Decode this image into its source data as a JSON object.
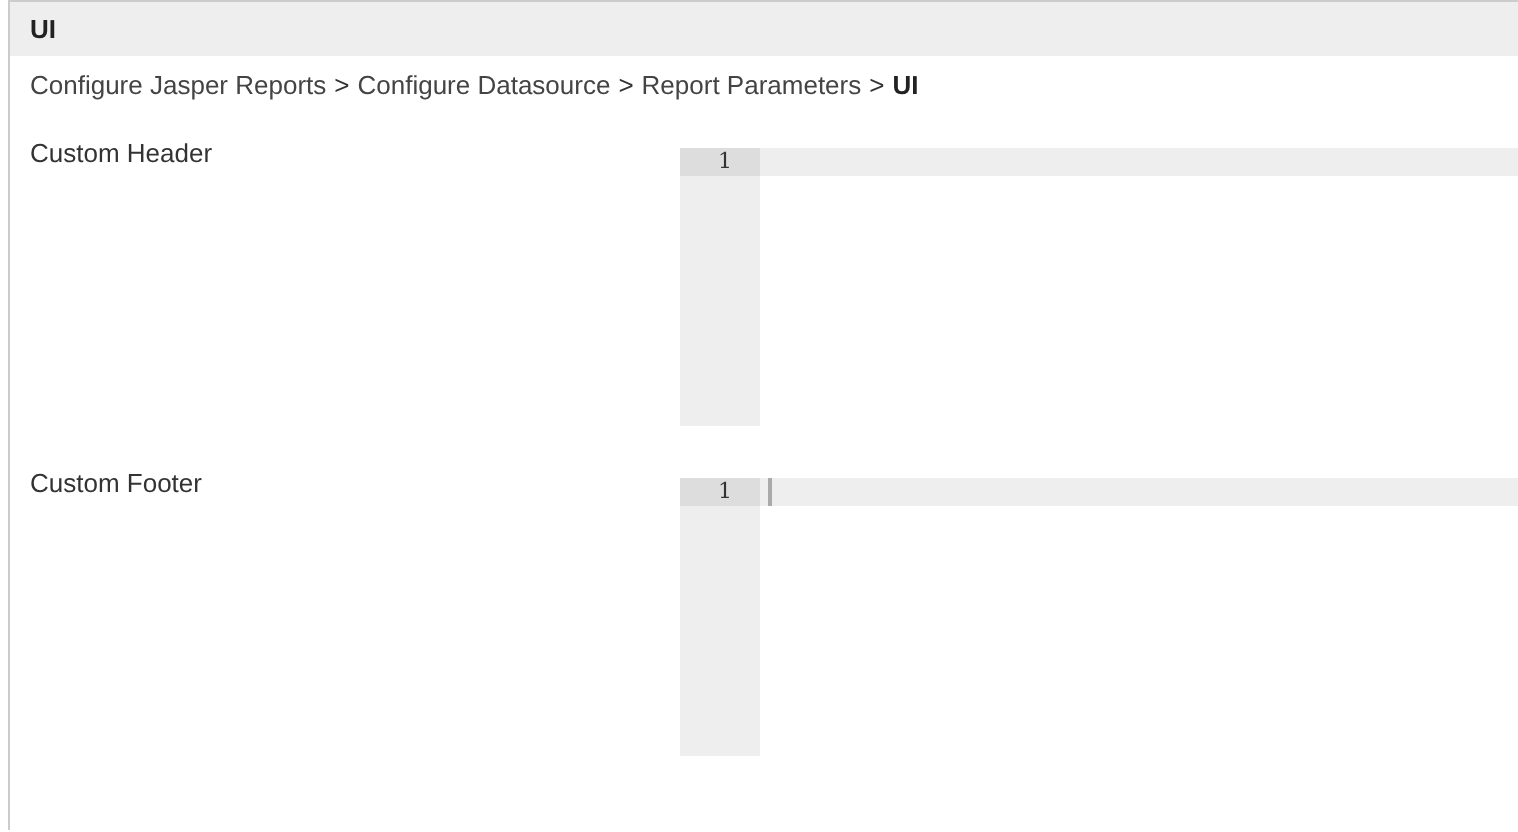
{
  "panel": {
    "title": "UI"
  },
  "breadcrumb": [
    {
      "kind": "link",
      "text": "Configure Jasper Reports"
    },
    {
      "kind": "separator",
      "text": ">"
    },
    {
      "kind": "link",
      "text": "Configure Datasource"
    },
    {
      "kind": "separator",
      "text": ">"
    },
    {
      "kind": "link",
      "text": "Report Parameters"
    },
    {
      "kind": "separator",
      "text": ">"
    },
    {
      "kind": "current",
      "text": "UI"
    }
  ],
  "fields": [
    {
      "label": "Custom Header",
      "line_number": "1",
      "focused": false
    },
    {
      "label": "Custom Footer",
      "line_number": "1",
      "focused": true
    }
  ]
}
